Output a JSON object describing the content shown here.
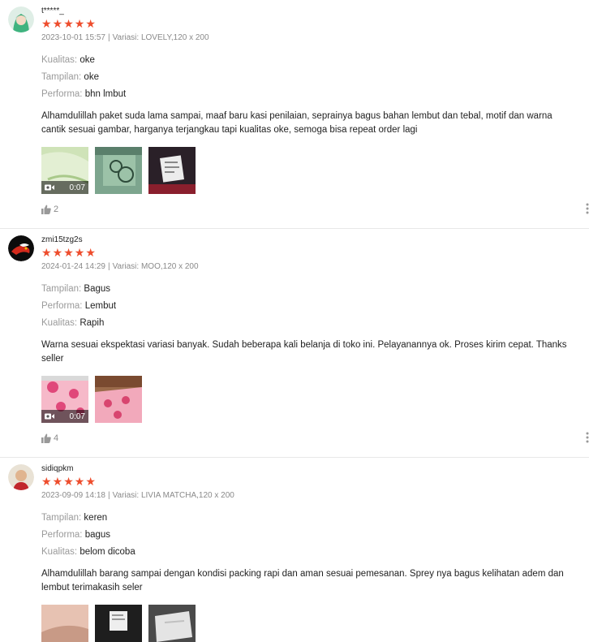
{
  "reviews": [
    {
      "author": "t*****_",
      "rating": 5,
      "date": "2023-10-01 15:57",
      "variation_label": "Variasi:",
      "variation": "LOVELY,120 x 200",
      "attributes": [
        {
          "label": "Kualitas:",
          "value": "oke"
        },
        {
          "label": "Tampilan:",
          "value": "oke"
        },
        {
          "label": "Performa:",
          "value": "bhn lmbut"
        }
      ],
      "comment": "Alhamdulillah paket suda lama sampai, maaf baru kasi penilaian, seprainya bagus bahan lembut dan tebal, motif dan warna cantik sesuai gambar, harganya terjangkau tapi kualitas oke, semoga bisa repeat order lagi",
      "video_duration": "0:07",
      "likes": "2"
    },
    {
      "author": "zmi15tzg2s",
      "rating": 5,
      "date": "2024-01-24 14:29",
      "variation_label": "Variasi:",
      "variation": "MOO,120 x 200",
      "attributes": [
        {
          "label": "Tampilan:",
          "value": "Bagus"
        },
        {
          "label": "Performa:",
          "value": "Lembut"
        },
        {
          "label": "Kualitas:",
          "value": "Rapih"
        }
      ],
      "comment": "Warna sesuai ekspektasi variasi banyak. Sudah beberapa kali belanja di toko ini. Pelayanannya ok. Proses kirim cepat. Thanks seller",
      "video_duration": "0:07",
      "likes": "4"
    },
    {
      "author": "sidiqpkm",
      "rating": 5,
      "date": "2023-09-09 14:18",
      "variation_label": "Variasi:",
      "variation": "LIVIA MATCHA,120 x 200",
      "attributes": [
        {
          "label": "Tampilan:",
          "value": "keren"
        },
        {
          "label": "Performa:",
          "value": "bagus"
        },
        {
          "label": "Kualitas:",
          "value": "belom dicoba"
        }
      ],
      "comment": "Alhamdulillah barang sampai dengan kondisi packing rapi dan aman sesuai pemesanan. Sprey nya bagus kelihatan adem dan lembut terimakasih seler"
    }
  ],
  "colors": {
    "star": "#ee4d2d",
    "muted": "#8a8a8a",
    "label": "#9a9a9a"
  },
  "icons": {
    "like": "thumbs-up-icon",
    "more": "more-vertical-icon",
    "video": "video-camera-icon",
    "star": "star-icon"
  }
}
